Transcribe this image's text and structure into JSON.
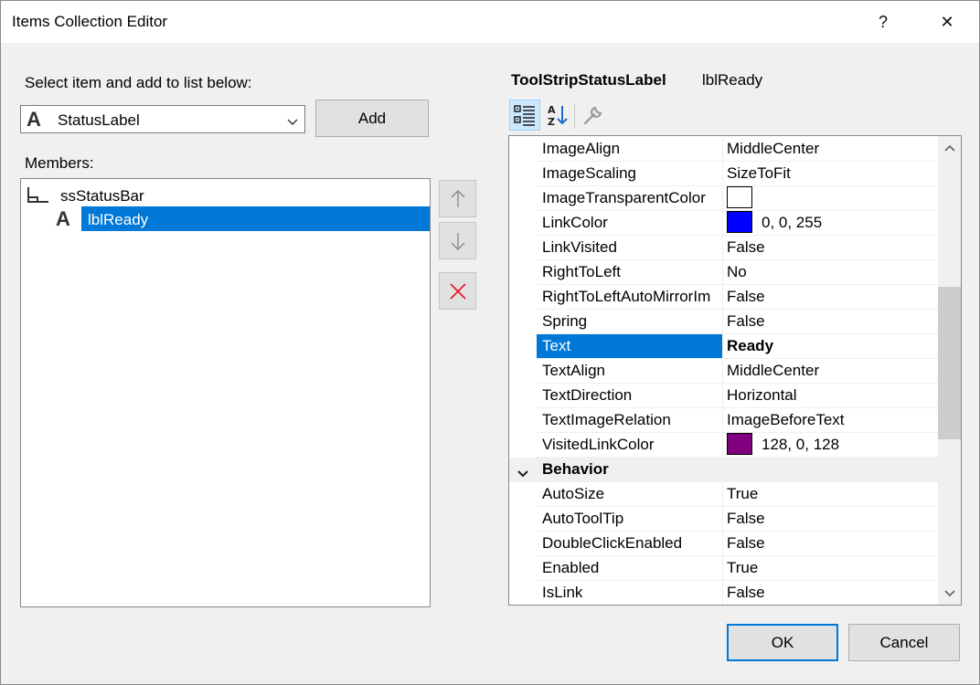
{
  "window": {
    "title": "Items Collection Editor",
    "help_glyph": "?",
    "close_glyph": "✕"
  },
  "selector": {
    "label": "Select item and add to list below:",
    "selected_type": "StatusLabel",
    "type_icon_glyph": "A",
    "add_label": "Add"
  },
  "members": {
    "label": "Members:",
    "items": [
      {
        "label": "ssStatusBar",
        "icon": "statusstrip-icon"
      },
      {
        "label": "lblReady",
        "icon": "label-icon",
        "icon_glyph": "A",
        "selected": true
      }
    ]
  },
  "object_header": {
    "type": "ToolStripStatusLabel",
    "name": "lblReady"
  },
  "property_grid": {
    "rows": [
      {
        "name": "ImageAlign",
        "value": "MiddleCenter"
      },
      {
        "name": "ImageScaling",
        "value": "SizeToFit"
      },
      {
        "name": "ImageTransparentColor",
        "value": "",
        "swatch": "#ffffff"
      },
      {
        "name": "LinkColor",
        "value": "0, 0, 255",
        "swatch": "#0000ff"
      },
      {
        "name": "LinkVisited",
        "value": "False"
      },
      {
        "name": "RightToLeft",
        "value": "No"
      },
      {
        "name": "RightToLeftAutoMirrorIm",
        "value": "False"
      },
      {
        "name": "Spring",
        "value": "False"
      },
      {
        "name": "Text",
        "value": "Ready",
        "selected": true
      },
      {
        "name": "TextAlign",
        "value": "MiddleCenter"
      },
      {
        "name": "TextDirection",
        "value": "Horizontal"
      },
      {
        "name": "TextImageRelation",
        "value": "ImageBeforeText"
      },
      {
        "name": "VisitedLinkColor",
        "value": "128, 0, 128",
        "swatch": "#800080"
      },
      {
        "name": "Behavior",
        "category": true
      },
      {
        "name": "AutoSize",
        "value": "True"
      },
      {
        "name": "AutoToolTip",
        "value": "False"
      },
      {
        "name": "DoubleClickEnabled",
        "value": "False"
      },
      {
        "name": "Enabled",
        "value": "True"
      },
      {
        "name": "IsLink",
        "value": "False"
      }
    ]
  },
  "footer": {
    "ok_label": "OK",
    "cancel_label": "Cancel"
  },
  "colors": {
    "accent": "#0078d7",
    "selection_text": "#ffffff"
  }
}
